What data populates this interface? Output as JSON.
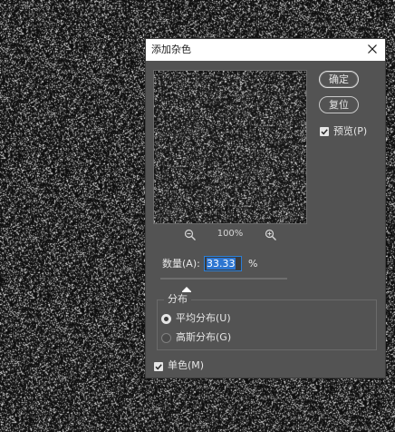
{
  "dialog": {
    "title": "添加杂色",
    "ok_label": "确定",
    "reset_label": "复位",
    "preview_label": "预览(P)",
    "preview_checked": true,
    "zoom_level": "100%",
    "amount_label": "数量(A):",
    "amount_value": "33.33",
    "amount_unit": "%",
    "amount_slider_percent": 33.33,
    "distribution": {
      "legend": "分布",
      "options": [
        {
          "label": "平均分布(U)",
          "selected": true
        },
        {
          "label": "高斯分布(G)",
          "selected": false
        }
      ]
    },
    "monochromatic_label": "单色(M)",
    "monochromatic_checked": true
  },
  "icons": {
    "close": "close-icon",
    "zoom_out": "zoom-out-icon",
    "zoom_in": "zoom-in-icon",
    "checkmark": "checkmark-icon"
  },
  "colors": {
    "dialog_bg": "#535353",
    "titlebar_bg": "#ffffff",
    "accent": "#2e76d1",
    "canvas_bg": "#0e0e0e"
  }
}
